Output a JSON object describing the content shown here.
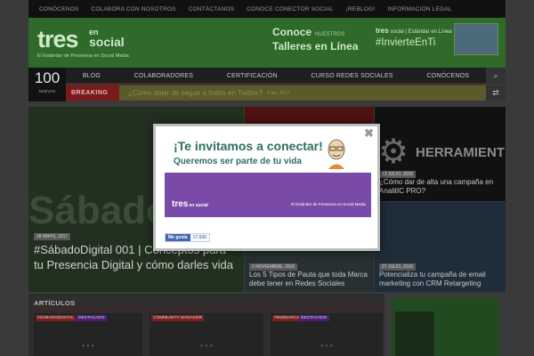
{
  "topnav": [
    "CONÓCENOS",
    "COLABORA CON NOSOTROS",
    "CONTÁCTANOS",
    "CONOCE CONECTOR SOCIAL",
    "¡REBLOG!",
    "INFORMACIÓN LEGAL"
  ],
  "logo": {
    "tres": "tres",
    "en": "en",
    "social": "social",
    "tagline": "El Estándar de Presencia en Social Media"
  },
  "ad": {
    "line1": "Conoce",
    "line1_small": "NUESTROS",
    "line2": "Talleres en Línea",
    "brand": "tres",
    "brand_suffix": "social",
    "brand_caption": "Estándar en Línea",
    "hashtag": "#InvierteEnTi"
  },
  "counter": {
    "value": "100",
    "label": "NUEVAS"
  },
  "mainnav": [
    "BLOG",
    "COLABORADORES",
    "CERTIFICACIÓN",
    "CURSO REDES SOCIALES",
    "CONÓCENOS"
  ],
  "breaking": {
    "label": "BREAKING",
    "text": "¿Cómo dejar de seguir a todos en Twitter?",
    "date": "8 Abr, 2017"
  },
  "tiles": {
    "main": {
      "bigword": "Sábado",
      "date": "28 MAYO, 2017",
      "title": "#SábadoDigital 001 | Conceptos para tu Presencia Digital y cómo darles vida"
    },
    "top_right": {
      "word": "HERRAMIENT",
      "date": "13 JULIO, 2016",
      "title": "¿Cómo dar de alta una campaña en AnalitIC PRO?"
    },
    "bottom_mid": {
      "date": "2 NOVIEMBRE, 2016",
      "title": "Los 5 Tipos de Pauta que toda Marca debe tener en Redes Sociales"
    },
    "bottom_right": {
      "date": "27 JULIO, 2016",
      "title": "Potencializa tu campaña de email marketing con CRM Retargeting"
    }
  },
  "articles": {
    "title": "ARTÍCULOS",
    "tags": [
      {
        "text": "#SÁBADODIGITAL",
        "color": "#9a2a2a"
      },
      {
        "text": "DESTACADO",
        "color": "#5a2a8a"
      },
      {
        "text": "COMMUNITY MANAGER",
        "color": "#9a2a2a"
      },
      {
        "text": "#MIZMARCA",
        "color": "#9a2a2a"
      },
      {
        "text": "DESTACADO",
        "color": "#5a2a8a"
      }
    ],
    "placeholder": "● ● ●"
  },
  "popup": {
    "heading1": "¡Te invitamos a conectar!",
    "heading2": "Queremos ser parte de tu vida",
    "logo": "tres",
    "logo_suffix": "en social",
    "tagline": "El Estándar de Presencia en Social Media",
    "like_label": "Me gusta",
    "like_count": "17.930"
  },
  "colors": {
    "brand_green": "#4caf50",
    "accent_red": "#c62828",
    "popup_purple": "#7a4aa8"
  }
}
